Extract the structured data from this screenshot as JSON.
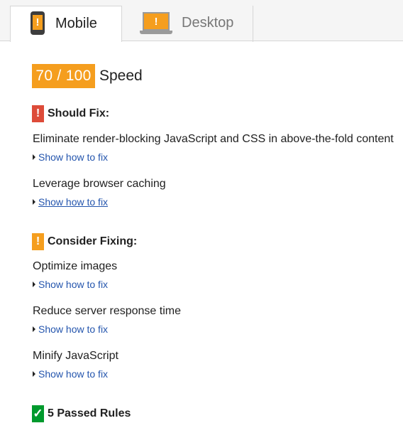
{
  "tabs": {
    "mobile": {
      "label": "Mobile",
      "icon": "mobile-phone-icon",
      "selected": true
    },
    "desktop": {
      "label": "Desktop",
      "icon": "laptop-icon",
      "selected": false
    }
  },
  "score": {
    "value": "70 / 100",
    "label": "Speed",
    "color": "#f59e1e"
  },
  "sections": {
    "should_fix": {
      "title": "Should Fix:",
      "icon": "exclamation-icon",
      "icon_color": "#dd4b39",
      "rules": [
        {
          "title": "Eliminate render-blocking JavaScript and CSS in above-the-fold content",
          "link": "Show how to fix"
        },
        {
          "title": "Leverage browser caching",
          "link": "Show how to fix"
        }
      ]
    },
    "consider_fixing": {
      "title": "Consider Fixing:",
      "icon": "exclamation-icon",
      "icon_color": "#f59e1e",
      "rules": [
        {
          "title": "Optimize images",
          "link": "Show how to fix"
        },
        {
          "title": "Reduce server response time",
          "link": "Show how to fix"
        },
        {
          "title": "Minify JavaScript",
          "link": "Show how to fix"
        }
      ]
    },
    "passed": {
      "title": "5 Passed Rules",
      "icon": "checkmark-icon",
      "icon_color": "#009a2d"
    }
  },
  "glyphs": {
    "exclamation": "!",
    "check": "✓"
  },
  "link_color": "#2455ad"
}
